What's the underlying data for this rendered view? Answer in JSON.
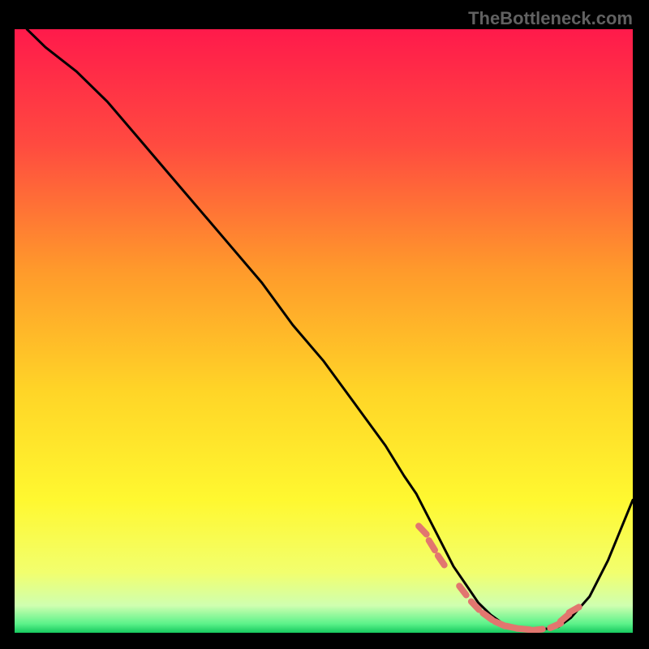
{
  "watermark": "TheBottleneck.com",
  "chart_data": {
    "type": "line",
    "title": "",
    "xlabel": "",
    "ylabel": "",
    "xlim": [
      0,
      100
    ],
    "ylim": [
      0,
      100
    ],
    "x": [
      2,
      5,
      10,
      15,
      20,
      25,
      30,
      35,
      40,
      45,
      50,
      55,
      60,
      63,
      65,
      67,
      69,
      71,
      73,
      75,
      77,
      79,
      81,
      83,
      85,
      88,
      90,
      93,
      96,
      100
    ],
    "values": [
      100,
      97,
      93,
      88,
      82,
      76,
      70,
      64,
      58,
      51,
      45,
      38,
      31,
      26,
      23,
      19,
      15,
      11,
      8,
      5,
      3,
      1.5,
      0.8,
      0.5,
      0.5,
      1,
      2.5,
      6,
      12,
      22
    ],
    "markers": {
      "x": [
        66,
        67.5,
        69,
        72.5,
        74.5,
        76.5,
        78.5,
        80.5,
        82.5,
        84.5,
        87.5,
        89,
        90.5
      ],
      "values": [
        17,
        14.5,
        12,
        7,
        4.5,
        2.7,
        1.5,
        0.9,
        0.6,
        0.5,
        1.2,
        2.5,
        3.8
      ]
    },
    "gradient_stops": [
      {
        "offset": 0,
        "color": "#ff1a4b"
      },
      {
        "offset": 0.19,
        "color": "#ff4a40"
      },
      {
        "offset": 0.4,
        "color": "#ff9a2b"
      },
      {
        "offset": 0.6,
        "color": "#ffd527"
      },
      {
        "offset": 0.78,
        "color": "#fff830"
      },
      {
        "offset": 0.9,
        "color": "#f2ff6e"
      },
      {
        "offset": 0.955,
        "color": "#cfffb0"
      },
      {
        "offset": 0.985,
        "color": "#5cf28a"
      },
      {
        "offset": 1.0,
        "color": "#16c95e"
      }
    ],
    "marker_color": "#e2766f",
    "line_color": "#000000"
  }
}
